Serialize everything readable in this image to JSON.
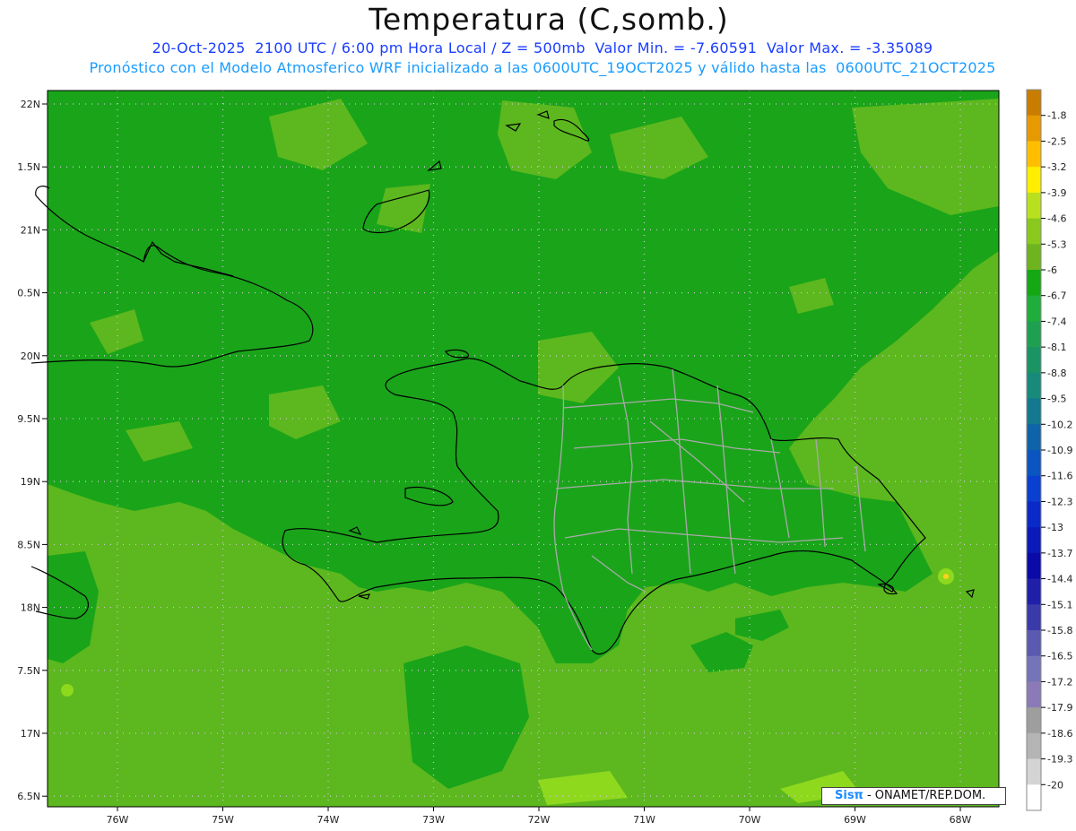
{
  "header": {
    "title": "Temperatura (C,somb.)",
    "subtitle_1": "20-Oct-2025  2100 UTC / 6:00 pm Hora Local / Z = 500mb  Valor Min. = -7.60591  Valor Max. = -3.35089",
    "subtitle_2": "Pronóstico con el Modelo Atmosferico WRF inicializado a las 0600UTC_19OCT2025 y válido hasta las  0600UTC_21OCT2025"
  },
  "map": {
    "lat_labels": [
      "22N",
      "1.5N",
      "21N",
      "0.5N",
      "20N",
      "9.5N",
      "19N",
      "8.5N",
      "18N",
      "7.5N",
      "17N",
      "6.5N"
    ],
    "lon_labels": [
      "76W",
      "75W",
      "74W",
      "73W",
      "72W",
      "71W",
      "70W",
      "69W",
      "68W"
    ],
    "field_min": -7.60591,
    "field_max": -3.35089,
    "dominant_color": "#1fa81f",
    "secondary_color": "#5cb81e",
    "coast_color": "#000000",
    "province_border_color": "#aaaaaa"
  },
  "colorbar": {
    "labels": [
      "-1.8",
      "-2.5",
      "-3.2",
      "-3.9",
      "-4.6",
      "-5.3",
      "-6",
      "-6.7",
      "-7.4",
      "-8.1",
      "-8.8",
      "-9.5",
      "-10.2",
      "-10.9",
      "-11.6",
      "-12.3",
      "-13",
      "-13.7",
      "-14.4",
      "-15.1",
      "-15.8",
      "-16.5",
      "-17.2",
      "-17.9",
      "-18.6",
      "-19.3",
      "-20"
    ],
    "colors": [
      "#c87d00",
      "#e69900",
      "#ffbf00",
      "#ffee00",
      "#b8e01e",
      "#8ac81e",
      "#6eb41e",
      "#15a815",
      "#1fae3c",
      "#1fa050",
      "#1a9463",
      "#178a7a",
      "#137890",
      "#0f63a8",
      "#0b55c0",
      "#0a40d0",
      "#0a2ac8",
      "#0a1ab8",
      "#0a0aa8",
      "#1f1faa",
      "#3a3aaa",
      "#5a5ab0",
      "#7474b8",
      "#8c7ab8",
      "#9e9e9e",
      "#b4b4b4",
      "#d4d4d4",
      "#ffffff"
    ]
  },
  "credit": {
    "logo": "Sisπ",
    "text": " - ONAMET/REP.DOM."
  }
}
